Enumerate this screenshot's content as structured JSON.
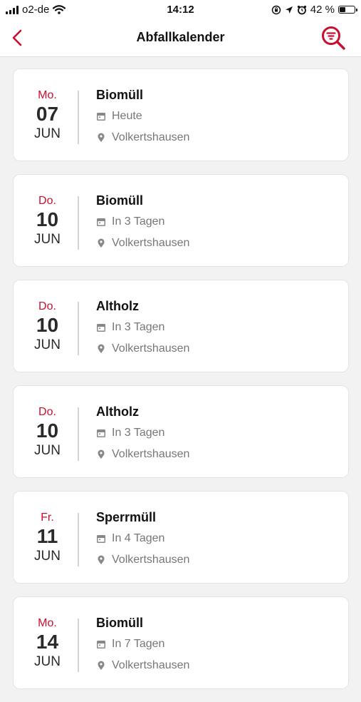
{
  "status": {
    "carrier": "o2-de",
    "time": "14:12",
    "battery": "42 %",
    "battery_level": 0.42
  },
  "nav": {
    "title": "Abfallkalender"
  },
  "colors": {
    "accent": "#c8102e"
  },
  "items": [
    {
      "dow": "Mo.",
      "day": "07",
      "month": "JUN",
      "type": "Biomüll",
      "when": "Heute",
      "place": "Volkertshausen"
    },
    {
      "dow": "Do.",
      "day": "10",
      "month": "JUN",
      "type": "Biomüll",
      "when": "In 3 Tagen",
      "place": "Volkertshausen"
    },
    {
      "dow": "Do.",
      "day": "10",
      "month": "JUN",
      "type": "Altholz",
      "when": "In 3 Tagen",
      "place": "Volkertshausen"
    },
    {
      "dow": "Do.",
      "day": "10",
      "month": "JUN",
      "type": "Altholz",
      "when": "In 3 Tagen",
      "place": "Volkertshausen"
    },
    {
      "dow": "Fr.",
      "day": "11",
      "month": "JUN",
      "type": "Sperrmüll",
      "when": "In 4 Tagen",
      "place": "Volkertshausen"
    },
    {
      "dow": "Mo.",
      "day": "14",
      "month": "JUN",
      "type": "Biomüll",
      "when": "In 7 Tagen",
      "place": "Volkertshausen"
    }
  ]
}
